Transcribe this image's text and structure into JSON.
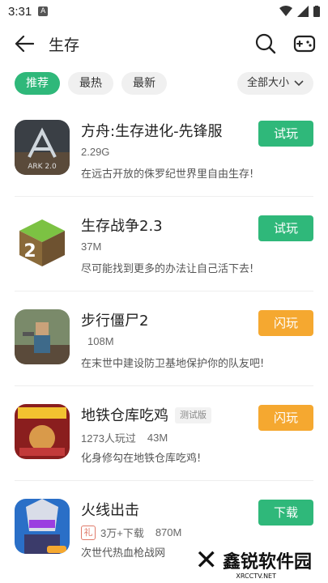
{
  "status": {
    "time": "3:31",
    "notif": "A"
  },
  "header": {
    "title": "生存"
  },
  "filters": {
    "chips": [
      "推荐",
      "最热",
      "最新"
    ],
    "active": 0,
    "size_label": "全部大小"
  },
  "games": [
    {
      "name": "方舟:生存进化-先锋服",
      "tag": "",
      "meta": "2.29G",
      "downloads": "",
      "desc": "在远古开放的侏罗纪世界里自由生存!",
      "button": "试玩",
      "button_color": "#2fb87a",
      "icon": "ark-icon"
    },
    {
      "name": "生存战争2.3",
      "tag": "",
      "meta": "37M",
      "downloads": "",
      "desc": "尽可能找到更多的办法让自己活下去!",
      "button": "试玩",
      "button_color": "#2fb87a",
      "icon": "survivalcraft-icon"
    },
    {
      "name": "步行僵尸2",
      "tag": "",
      "meta": "108M",
      "downloads": "",
      "desc": "在末世中建设防卫基地保护你的队友吧!",
      "button": "闪玩",
      "button_color": "#f5a830",
      "icon": "walking-zombie-icon"
    },
    {
      "name": "地铁仓库吃鸡",
      "tag": "测试版",
      "meta": "43M",
      "downloads": "1273人玩过",
      "desc": "化身修勾在地铁仓库吃鸡!",
      "button": "闪玩",
      "button_color": "#f5a830",
      "icon": "dog-game-icon"
    },
    {
      "name": "火线出击",
      "tag": "",
      "meta": "870M",
      "downloads": "3万+下载",
      "desc": "次世代热血枪战网",
      "button": "下载",
      "button_color": "#2fb87a",
      "icon": "fire-strike-icon",
      "badge": "礼"
    }
  ],
  "watermark": {
    "text": "鑫锐软件园",
    "sub": "XRCCTV.NET"
  }
}
